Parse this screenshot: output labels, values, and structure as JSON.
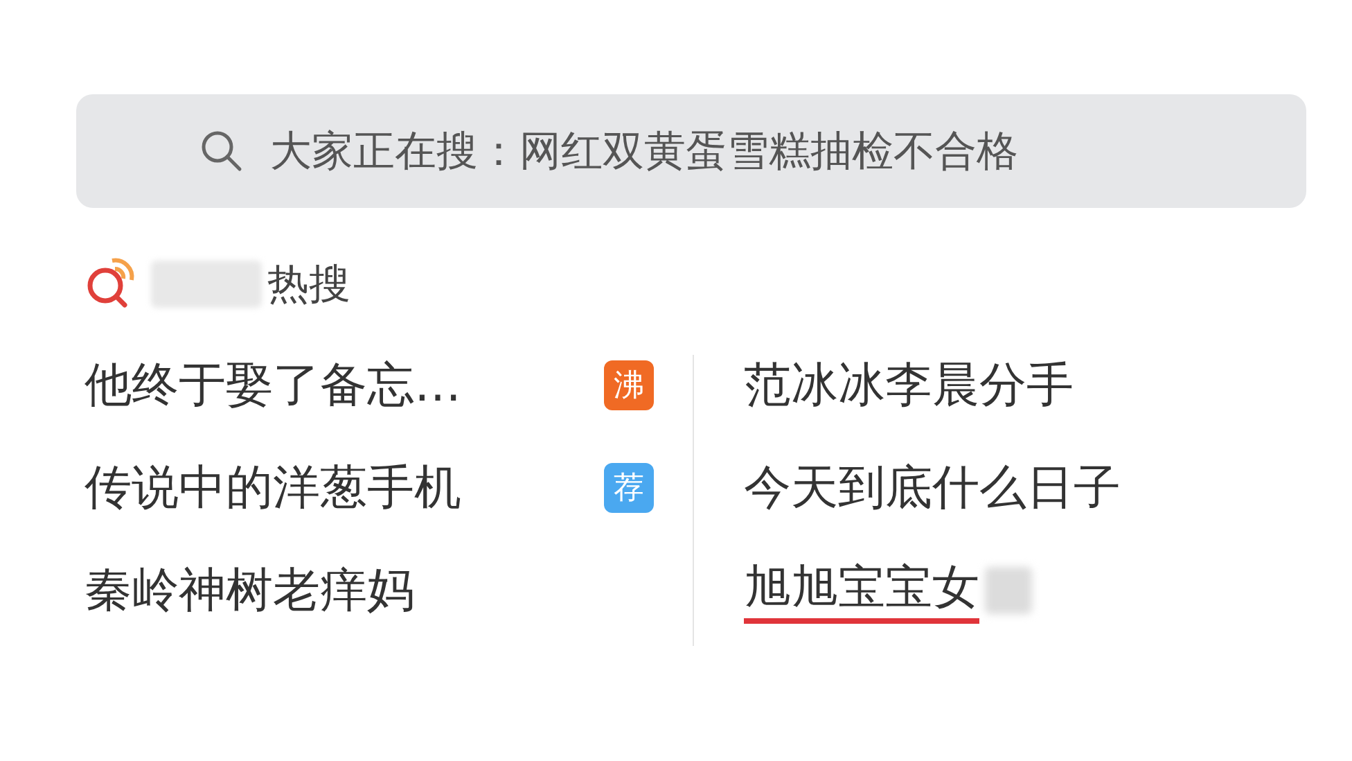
{
  "search": {
    "placeholder": "大家正在搜：网红双黄蛋雪糕抽检不合格"
  },
  "section": {
    "title": "热搜",
    "redacted": true
  },
  "columns": [
    [
      {
        "text": "他终于娶了备忘…",
        "badge": {
          "text": "沸",
          "color": "#f06a24"
        },
        "underlined": false
      },
      {
        "text": "传说中的洋葱手机",
        "badge": {
          "text": "荐",
          "color": "#4aa8f0"
        },
        "underlined": false
      },
      {
        "text": "秦岭神树老痒妈",
        "underlined": false
      }
    ],
    [
      {
        "text": "范冰冰李晨分手",
        "underlined": false
      },
      {
        "text": "今天到底什么日子",
        "underlined": false
      },
      {
        "text": "旭旭宝宝女",
        "underlined": true,
        "redacted": true
      }
    ]
  ]
}
